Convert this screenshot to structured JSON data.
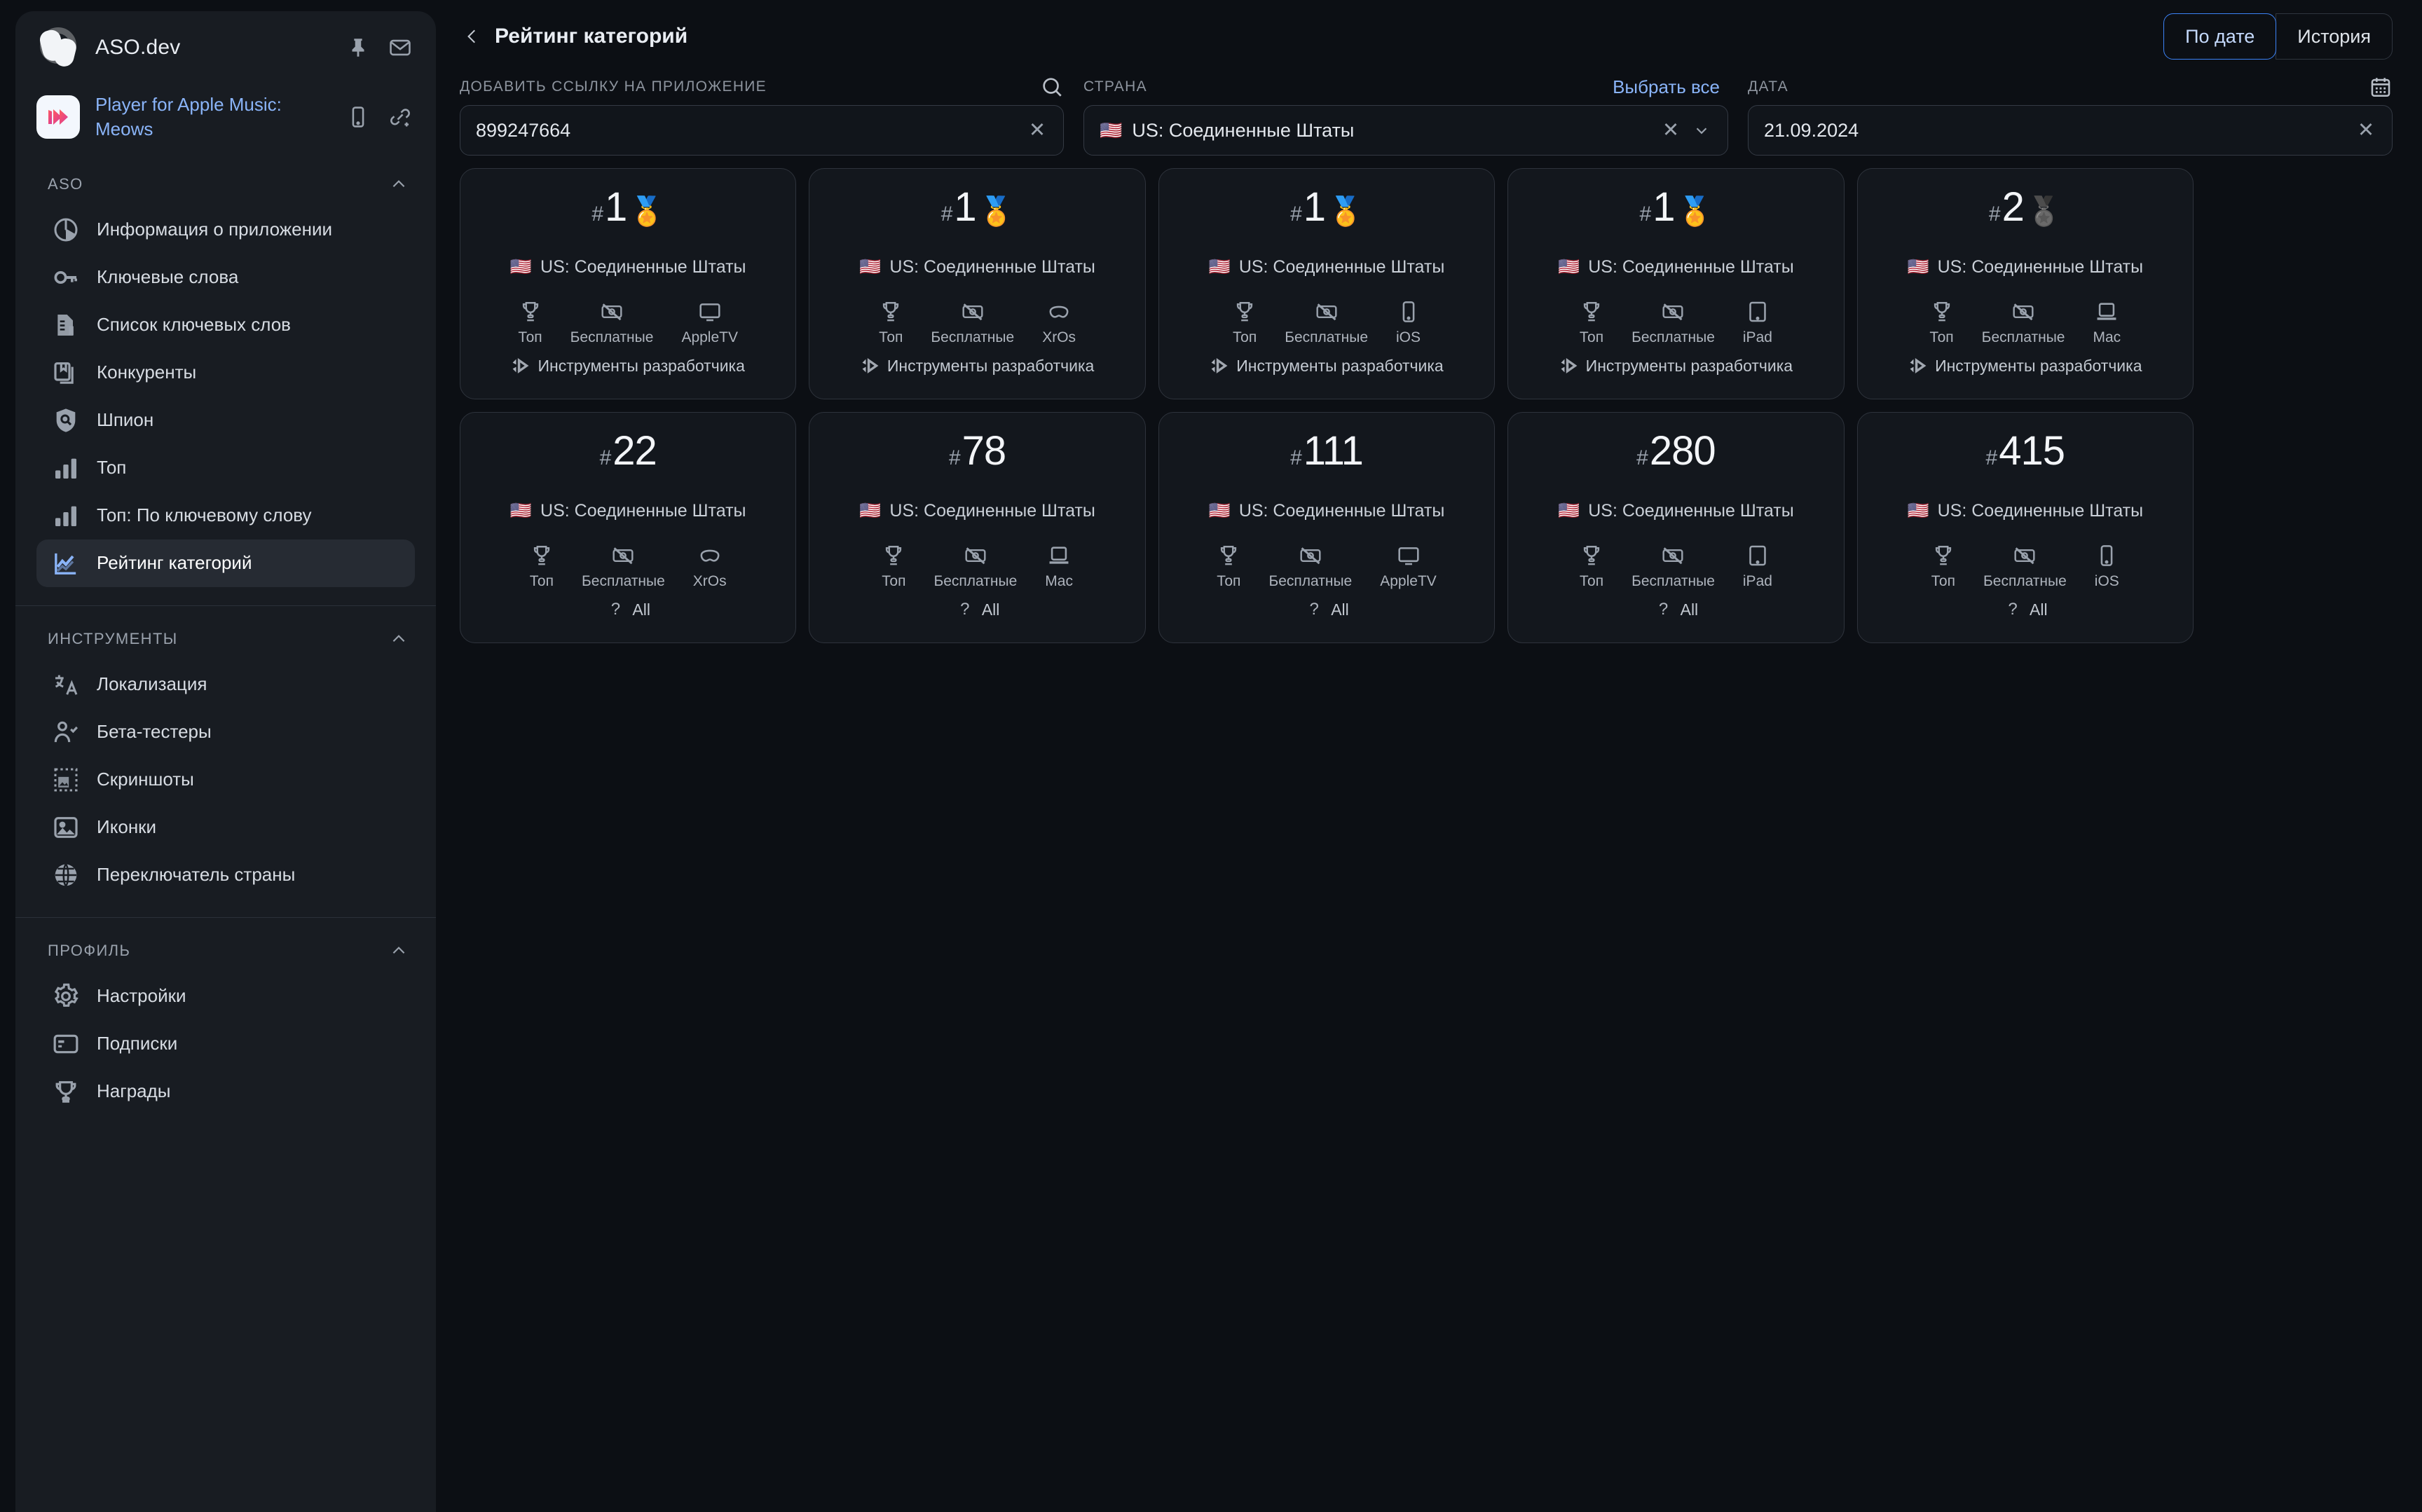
{
  "brand": {
    "name": "ASO.dev",
    "pin_icon": "pin-icon",
    "mail_icon": "mail-icon"
  },
  "app": {
    "title": "Player for Apple Music: Meows",
    "device_icon": "mobile-icon",
    "link_icon": "link-add-icon"
  },
  "sidebar": {
    "sections": [
      {
        "title": "ASO",
        "collapse_icon": "chevron-up-icon",
        "items": [
          {
            "label": "Информация о приложении",
            "icon": "pie-chart-icon",
            "active": false
          },
          {
            "label": "Ключевые слова",
            "icon": "key-icon",
            "active": false
          },
          {
            "label": "Список ключевых слов",
            "icon": "document-list-icon",
            "active": false
          },
          {
            "label": "Конкуренты",
            "icon": "books-icon",
            "active": false
          },
          {
            "label": "Шпион",
            "icon": "shield-search-icon",
            "active": false
          },
          {
            "label": "Топ",
            "icon": "bar-chart-icon",
            "active": false
          },
          {
            "label": "Топ: По ключевому слову",
            "icon": "bar-chart-icon",
            "active": false
          },
          {
            "label": "Рейтинг категорий",
            "icon": "line-chart-icon",
            "active": true
          }
        ]
      },
      {
        "title": "ИНСТРУМЕНТЫ",
        "collapse_icon": "chevron-up-icon",
        "items": [
          {
            "label": "Локализация",
            "icon": "translate-icon",
            "active": false
          },
          {
            "label": "Бета-тестеры",
            "icon": "user-check-icon",
            "active": false
          },
          {
            "label": "Скриншоты",
            "icon": "screenshot-icon",
            "active": false
          },
          {
            "label": "Иконки",
            "icon": "image-icon",
            "active": false
          },
          {
            "label": "Переключатель страны",
            "icon": "globe-icon",
            "active": false
          }
        ]
      },
      {
        "title": "ПРОФИЛЬ",
        "collapse_icon": "chevron-up-icon",
        "items": [
          {
            "label": "Настройки",
            "icon": "gear-icon",
            "active": false
          },
          {
            "label": "Подписки",
            "icon": "credit-card-icon",
            "active": false
          },
          {
            "label": "Награды",
            "icon": "trophy-icon",
            "active": false
          }
        ]
      }
    ]
  },
  "topbar": {
    "back_icon": "chevron-left-icon",
    "title": "Рейтинг категорий",
    "segments": [
      {
        "label": "По дате",
        "selected": true
      },
      {
        "label": "История",
        "selected": false
      }
    ]
  },
  "filters": {
    "app": {
      "label": "Добавить ссылку на приложение",
      "value": "899247664",
      "search_icon": "search-icon",
      "clear_icon": "close-icon"
    },
    "country": {
      "label": "Страна",
      "select_all_label": "Выбрать все",
      "flag": "🇺🇸",
      "value": "US: Соединенные Штаты",
      "clear_icon": "close-icon",
      "caret_icon": "chevron-down-icon"
    },
    "date": {
      "label": "Дата",
      "value": "21.09.2024",
      "calendar_icon": "calendar-icon",
      "clear_icon": "close-icon"
    }
  },
  "cards": [
    {
      "hash": "#",
      "rank": "1",
      "medal": "🏅",
      "medal_grey": false,
      "flag": "🇺🇸",
      "country": "US: Соединенные Штаты",
      "attrs": [
        {
          "icon": "trophy-icon",
          "label": "Топ"
        },
        {
          "icon": "no-money-icon",
          "label": "Бесплатные"
        },
        {
          "icon": "tv-icon",
          "label": "AppleTV"
        }
      ],
      "category": {
        "icon": "devtools-icon",
        "label": "Инструменты разработчика"
      }
    },
    {
      "hash": "#",
      "rank": "1",
      "medal": "🏅",
      "medal_grey": false,
      "flag": "🇺🇸",
      "country": "US: Соединенные Штаты",
      "attrs": [
        {
          "icon": "trophy-icon",
          "label": "Топ"
        },
        {
          "icon": "no-money-icon",
          "label": "Бесплатные"
        },
        {
          "icon": "vision-icon",
          "label": "XrOs"
        }
      ],
      "category": {
        "icon": "devtools-icon",
        "label": "Инструменты разработчика"
      }
    },
    {
      "hash": "#",
      "rank": "1",
      "medal": "🏅",
      "medal_grey": false,
      "flag": "🇺🇸",
      "country": "US: Соединенные Штаты",
      "attrs": [
        {
          "icon": "trophy-icon",
          "label": "Топ"
        },
        {
          "icon": "no-money-icon",
          "label": "Бесплатные"
        },
        {
          "icon": "iphone-icon",
          "label": "iOS"
        }
      ],
      "category": {
        "icon": "devtools-icon",
        "label": "Инструменты разработчика"
      }
    },
    {
      "hash": "#",
      "rank": "1",
      "medal": "🏅",
      "medal_grey": false,
      "flag": "🇺🇸",
      "country": "US: Соединенные Штаты",
      "attrs": [
        {
          "icon": "trophy-icon",
          "label": "Топ"
        },
        {
          "icon": "no-money-icon",
          "label": "Бесплатные"
        },
        {
          "icon": "ipad-icon",
          "label": "iPad"
        }
      ],
      "category": {
        "icon": "devtools-icon",
        "label": "Инструменты разработчика"
      }
    },
    {
      "hash": "#",
      "rank": "2",
      "medal": "🏅",
      "medal_grey": true,
      "flag": "🇺🇸",
      "country": "US: Соединенные Штаты",
      "attrs": [
        {
          "icon": "trophy-icon",
          "label": "Топ"
        },
        {
          "icon": "no-money-icon",
          "label": "Бесплатные"
        },
        {
          "icon": "mac-icon",
          "label": "Mac"
        }
      ],
      "category": {
        "icon": "devtools-icon",
        "label": "Инструменты разработчика"
      }
    },
    {
      "hash": "#",
      "rank": "22",
      "medal": "",
      "medal_grey": false,
      "flag": "🇺🇸",
      "country": "US: Соединенные Штаты",
      "attrs": [
        {
          "icon": "trophy-icon",
          "label": "Топ"
        },
        {
          "icon": "no-money-icon",
          "label": "Бесплатные"
        },
        {
          "icon": "vision-icon",
          "label": "XrOs"
        }
      ],
      "category": {
        "icon": "question-icon",
        "label": "All"
      }
    },
    {
      "hash": "#",
      "rank": "78",
      "medal": "",
      "medal_grey": false,
      "flag": "🇺🇸",
      "country": "US: Соединенные Штаты",
      "attrs": [
        {
          "icon": "trophy-icon",
          "label": "Топ"
        },
        {
          "icon": "no-money-icon",
          "label": "Бесплатные"
        },
        {
          "icon": "mac-icon",
          "label": "Mac"
        }
      ],
      "category": {
        "icon": "question-icon",
        "label": "All"
      }
    },
    {
      "hash": "#",
      "rank": "111",
      "medal": "",
      "medal_grey": false,
      "flag": "🇺🇸",
      "country": "US: Соединенные Штаты",
      "attrs": [
        {
          "icon": "trophy-icon",
          "label": "Топ"
        },
        {
          "icon": "no-money-icon",
          "label": "Бесплатные"
        },
        {
          "icon": "tv-icon",
          "label": "AppleTV"
        }
      ],
      "category": {
        "icon": "question-icon",
        "label": "All"
      }
    },
    {
      "hash": "#",
      "rank": "280",
      "medal": "",
      "medal_grey": false,
      "flag": "🇺🇸",
      "country": "US: Соединенные Штаты",
      "attrs": [
        {
          "icon": "trophy-icon",
          "label": "Топ"
        },
        {
          "icon": "no-money-icon",
          "label": "Бесплатные"
        },
        {
          "icon": "ipad-icon",
          "label": "iPad"
        }
      ],
      "category": {
        "icon": "question-icon",
        "label": "All"
      }
    },
    {
      "hash": "#",
      "rank": "415",
      "medal": "",
      "medal_grey": false,
      "flag": "🇺🇸",
      "country": "US: Соединенные Штаты",
      "attrs": [
        {
          "icon": "trophy-icon",
          "label": "Топ"
        },
        {
          "icon": "no-money-icon",
          "label": "Бесплатные"
        },
        {
          "icon": "iphone-icon",
          "label": "iOS"
        }
      ],
      "category": {
        "icon": "question-icon",
        "label": "All"
      }
    }
  ]
}
